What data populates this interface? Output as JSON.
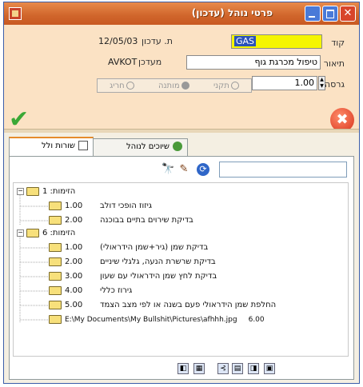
{
  "window": {
    "title": "פרטי נוהל (עדכון)",
    "close_glyph": "✕"
  },
  "form": {
    "code_label": "קוד",
    "code_value": "GAS",
    "date_label": "ת. עדכון",
    "date_value": "12/05/03",
    "updater_label": "מעדכן",
    "updater_value": "AVKOT",
    "desc_label": "תיאור",
    "desc_value": "טיפול מכרגת גוף",
    "version_label": "גרסה",
    "version_value": "1.00",
    "radio_options": [
      "תקני",
      "מותנה",
      "חריג"
    ],
    "ok_glyph": "✔",
    "cancel_glyph": "✖"
  },
  "tabs": [
    {
      "label": "שורות ולל",
      "active": true
    },
    {
      "label": "שיוכים לנוהל",
      "active": false
    }
  ],
  "toolbar": {
    "search_value": "",
    "binoculars_glyph": "🔭",
    "edit_glyph": "✎",
    "refresh_glyph": "⟳"
  },
  "tree": [
    {
      "level": 0,
      "expander": "−",
      "value": "",
      "desc": "הזימות: 1"
    },
    {
      "level": 1,
      "expander": "",
      "value": "1.00",
      "desc": "גיזוז הופכי דולב"
    },
    {
      "level": 1,
      "expander": "",
      "value": "2.00",
      "desc": "בדיקת שירוים בתיים בבוכנה"
    },
    {
      "level": 0,
      "expander": "−",
      "value": "",
      "desc": "הזימות: 6"
    },
    {
      "level": 1,
      "expander": "",
      "value": "1.00",
      "desc": "בדיקת שמן (גיר+שמן הידראולי)"
    },
    {
      "level": 1,
      "expander": "",
      "value": "2.00",
      "desc": "בדיקת שרשרת הנעה, גלגלי שיניים"
    },
    {
      "level": 1,
      "expander": "",
      "value": "3.00",
      "desc": "בדיקת לחץ שמן הידראולי עם שעון"
    },
    {
      "level": 1,
      "expander": "",
      "value": "4.00",
      "desc": "גירוז כללי"
    },
    {
      "level": 1,
      "expander": "",
      "value": "5.00",
      "desc": "החלפת שמן הידראולי פעם בשנה או לפי מצב הצמד"
    },
    {
      "level": 1,
      "expander": "",
      "value": "E:\\My Documents\\My Bullshit\\Pictures\\afhhh.jpg",
      "desc": "6.00"
    }
  ],
  "bottom_toolbar": [
    "◧",
    "▦",
    "⊰",
    "▤",
    "◨",
    "▣"
  ]
}
